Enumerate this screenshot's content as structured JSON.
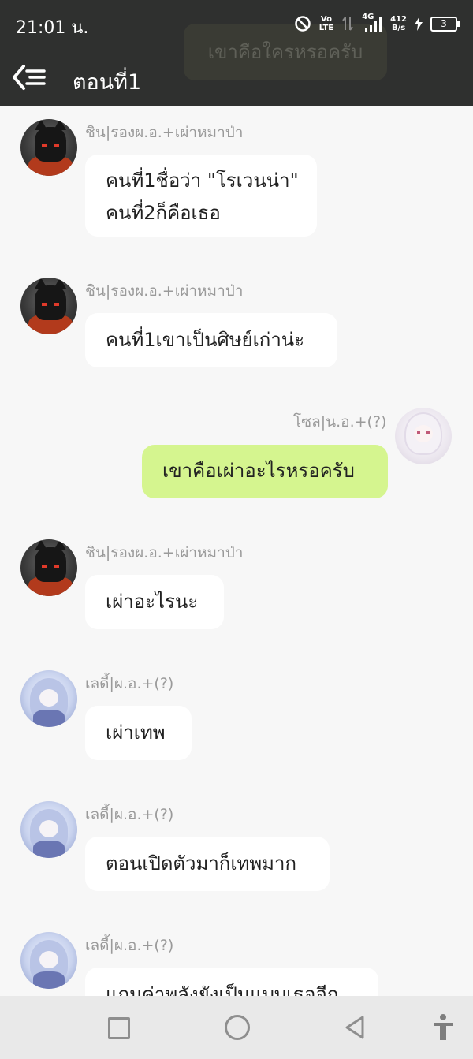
{
  "status_bar": {
    "time": "21:01 น.",
    "net_top": "Vo",
    "net_bottom": "LTE",
    "signal_label": "4G",
    "speed_top": "412",
    "speed_bottom": "B/s",
    "battery": "3"
  },
  "header": {
    "title": "ตอนที่1",
    "ghost_message": "เขาคือใครหรอครับ"
  },
  "messages": [
    {
      "author": "ชิน|รองผ.อ.+เผ่าหมาป่า",
      "text": "คนที่1ชื่อว่า \"โรเวนน่า\"\nคนที่2ก็คือเธอ",
      "side": "left",
      "avatar": "dark-cat-avatar"
    },
    {
      "author": "ชิน|รองผ.อ.+เผ่าหมาป่า",
      "text": "คนที่1เขาเป็นศิษย์เก่าน่ะ",
      "side": "left",
      "avatar": "dark-cat-avatar"
    },
    {
      "author": "โซล|น.อ.+(?)",
      "text": "เขาคือเผ่าอะไรหรอครับ",
      "side": "right",
      "avatar": "white-hair-avatar"
    },
    {
      "author": "ชิน|รองผ.อ.+เผ่าหมาป่า",
      "text": "เผ่าอะไรนะ",
      "side": "left",
      "avatar": "dark-cat-avatar"
    },
    {
      "author": "เลดี้|ผ.อ.+(?)",
      "text": "เผ่าเทพ",
      "side": "left",
      "avatar": "blue-hair-avatar"
    },
    {
      "author": "เลดี้|ผ.อ.+(?)",
      "text": "ตอนเปิดตัวมาก็เทพมาก",
      "side": "left",
      "avatar": "blue-hair-avatar"
    },
    {
      "author": "เลดี้|ผ.อ.+(?)",
      "text": "แถมค่าพลังยังเป็นแบบเธออีก",
      "side": "left",
      "avatar": "blue-hair-avatar"
    }
  ],
  "colors": {
    "header_bg": "#2f302f",
    "chat_bg": "#f7f7f7",
    "own_bubble": "#d5f58f",
    "other_bubble": "#ffffff"
  }
}
